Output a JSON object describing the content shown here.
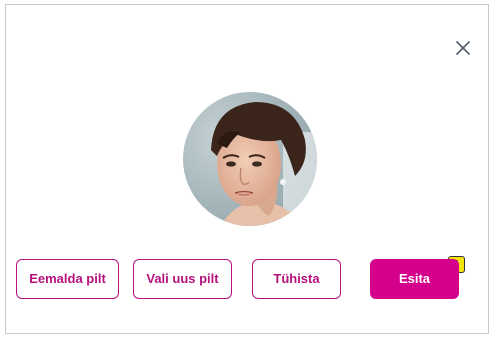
{
  "dialog": {
    "close_icon": "close-icon",
    "avatar_alt": "profile photo",
    "buttons": {
      "remove_label": "Eemalda pilt",
      "choose_label": "Vali uus pilt",
      "cancel_label": "Tühista",
      "submit_label": "Esita"
    },
    "warning_badge": "!"
  },
  "colors": {
    "accent": "#d4008c",
    "accent_border": "#b5127d",
    "warning": "#f5e30c",
    "border": "#c9c9c9"
  }
}
